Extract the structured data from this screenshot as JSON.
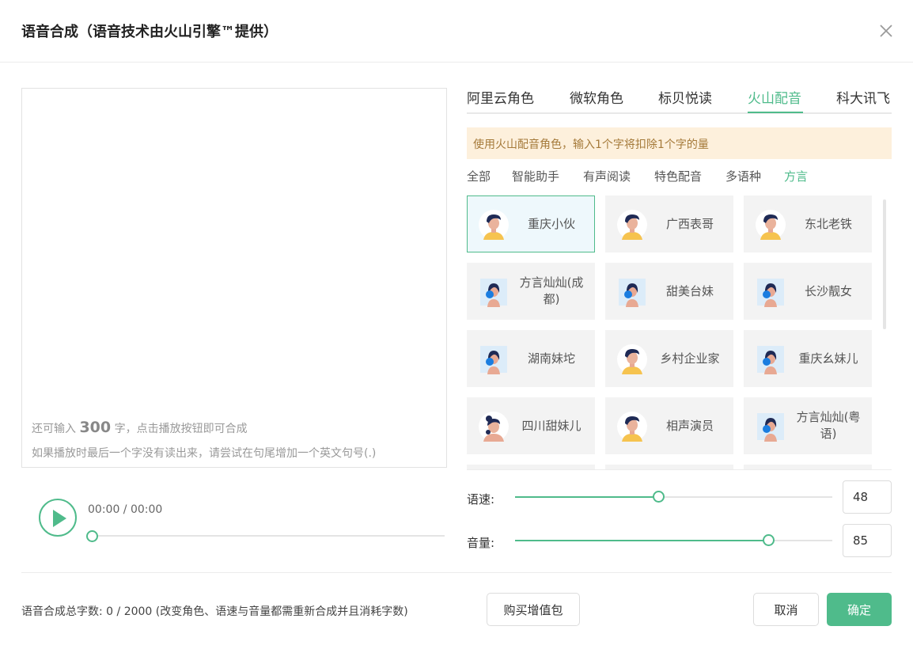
{
  "dialog": {
    "title": "语音合成（语音技术由火山引擎™提供）",
    "close_icon": "close-icon"
  },
  "editor": {
    "text": "",
    "hint_prefix": "还可输入",
    "hint_count": "300",
    "hint_suffix": "字，点击播放按钮即可合成",
    "hint_line2": "如果播放时最后一个字没有读出来，请尝试在句尾增加一个英文句号(.)"
  },
  "player": {
    "play_icon": "play-icon",
    "time": "00:00 / 00:00",
    "progress": 0
  },
  "tabs": [
    {
      "label": "阿里云角色",
      "active": false
    },
    {
      "label": "微软角色",
      "active": false
    },
    {
      "label": "标贝悦读",
      "active": false
    },
    {
      "label": "火山配音",
      "active": true
    },
    {
      "label": "科大讯飞",
      "active": false
    }
  ],
  "notice": "使用火山配音角色，输入1个字将扣除1个字的量",
  "categories": [
    {
      "label": "全部",
      "active": false
    },
    {
      "label": "智能助手",
      "active": false
    },
    {
      "label": "有声阅读",
      "active": false
    },
    {
      "label": "特色配音",
      "active": false
    },
    {
      "label": "多语种",
      "active": false
    },
    {
      "label": "方言",
      "active": true
    }
  ],
  "voices": [
    {
      "name": "重庆小伙",
      "avatar": "male-avatar-icon",
      "selected": true
    },
    {
      "name": "广西表哥",
      "avatar": "male-avatar-icon",
      "selected": false
    },
    {
      "name": "东北老铁",
      "avatar": "male-avatar-icon",
      "selected": false
    },
    {
      "name": "方言灿灿(成都)",
      "avatar": "female-avatar-icon",
      "selected": false
    },
    {
      "name": "甜美台妹",
      "avatar": "female-avatar-icon",
      "selected": false
    },
    {
      "name": "长沙靓女",
      "avatar": "female-avatar-icon",
      "selected": false
    },
    {
      "name": "湖南妹坨",
      "avatar": "female-avatar-icon",
      "selected": false
    },
    {
      "name": "乡村企业家",
      "avatar": "male-avatar-icon",
      "selected": false
    },
    {
      "name": "重庆幺妹儿",
      "avatar": "female-avatar-icon",
      "selected": false
    },
    {
      "name": "四川甜妹儿",
      "avatar": "bun-girl-avatar-icon",
      "selected": false
    },
    {
      "name": "相声演员",
      "avatar": "male-avatar-icon",
      "selected": false
    },
    {
      "name": "方言灿灿(粤语)",
      "avatar": "female-avatar-icon",
      "selected": false
    }
  ],
  "speed": {
    "label": "语速:",
    "value": "48",
    "fraction": 0.48
  },
  "volume": {
    "label": "音量:",
    "value": "85",
    "fraction": 0.85
  },
  "footer": {
    "total_text": "语音合成总字数:  0 / 2000  (改变角色、语速与音量都需重新合成并且消耗字数)",
    "buy_label": "购买增值包",
    "cancel_label": "取消",
    "ok_label": "确定"
  },
  "colors": {
    "accent": "#4fbb8b",
    "notice_bg": "#fdf0dc",
    "notice_text": "#a57a3a"
  }
}
